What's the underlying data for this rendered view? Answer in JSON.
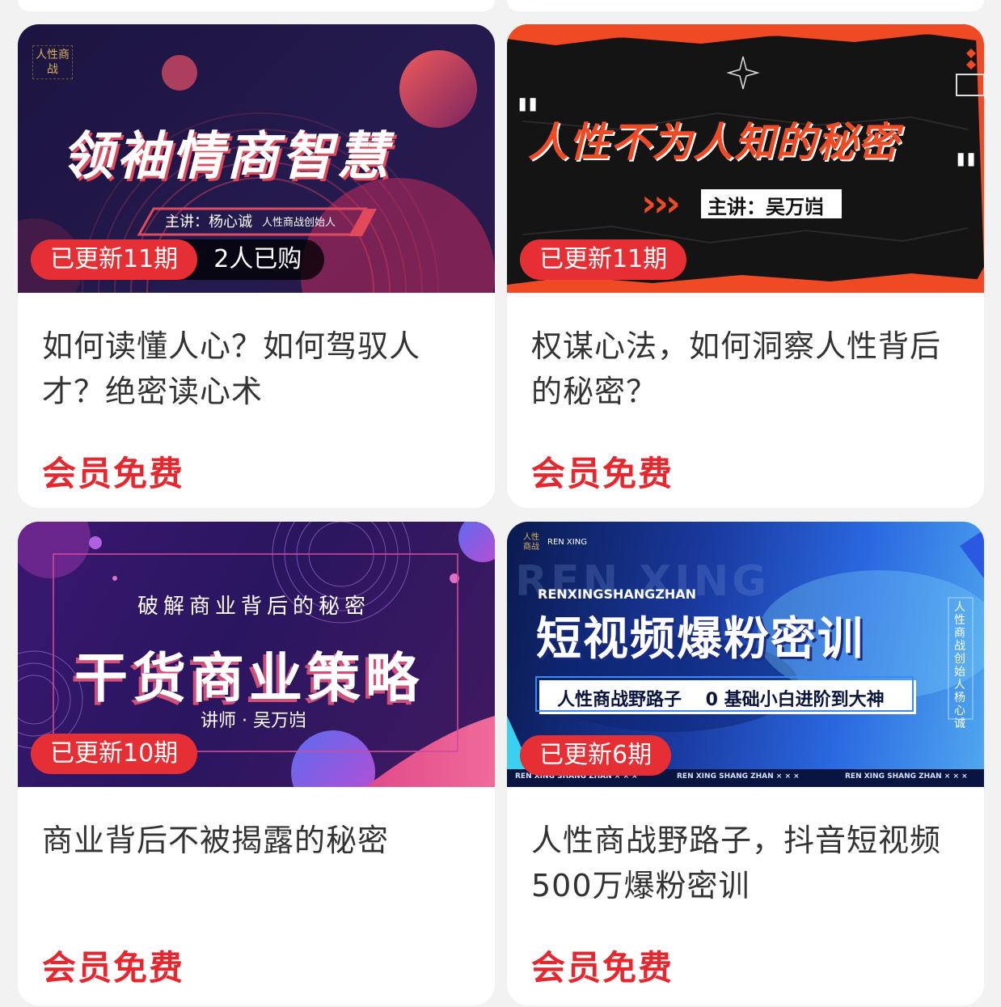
{
  "cards": [
    {
      "banner": {
        "logo": "人性商战",
        "headline": "领袖情商智慧",
        "host_label": "主讲：杨心诚",
        "host_sub": "人性商战创始人"
      },
      "updated": "已更新11期",
      "purchased": "2人已购",
      "title": "如何读懂人心？如何驾驭人才？绝密读心术",
      "price": "会员免费"
    },
    {
      "banner": {
        "headline": "人性不为人知的秘密",
        "quote_open": "\"",
        "quote_close": "\"",
        "host_label": "主讲：吴万岿",
        "chevrons": "›››"
      },
      "updated": "已更新11期",
      "title": "权谋心法，如何洞察人性背后的秘密？",
      "price": "会员免费"
    },
    {
      "banner": {
        "subtitle": "破解商业背后的秘密",
        "headline": "干货商业策略",
        "host_label": "讲师 · 吴万岿"
      },
      "updated": "已更新10期",
      "title": "商业背后不被揭露的秘密",
      "price": "会员免费"
    },
    {
      "banner": {
        "logo": "人性商战",
        "brand_small": "REN XING",
        "bg_text": "REN XING",
        "pinyin": "RENXINGSHANGZHAN",
        "headline": "短视频爆粉密训",
        "strip": "人性商战野路子　 0 基础小白进阶到大神",
        "side_text": "人性商战创始人 杨心诚",
        "footer_items": [
          "REN XING SHANG ZHAN × × ×",
          "REN XING SHANG ZHAN × × ×",
          "REN XING SHANG ZHAN × × ×"
        ]
      },
      "updated": "已更新6期",
      "title": "人性商战野路子，抖音短视频500万爆粉密训",
      "price": "会员免费"
    }
  ],
  "colors": {
    "accent_red": "#e8262e",
    "badge_red": "#e62f34",
    "title_text": "#333333",
    "page_bg": "#f2f2f2"
  }
}
